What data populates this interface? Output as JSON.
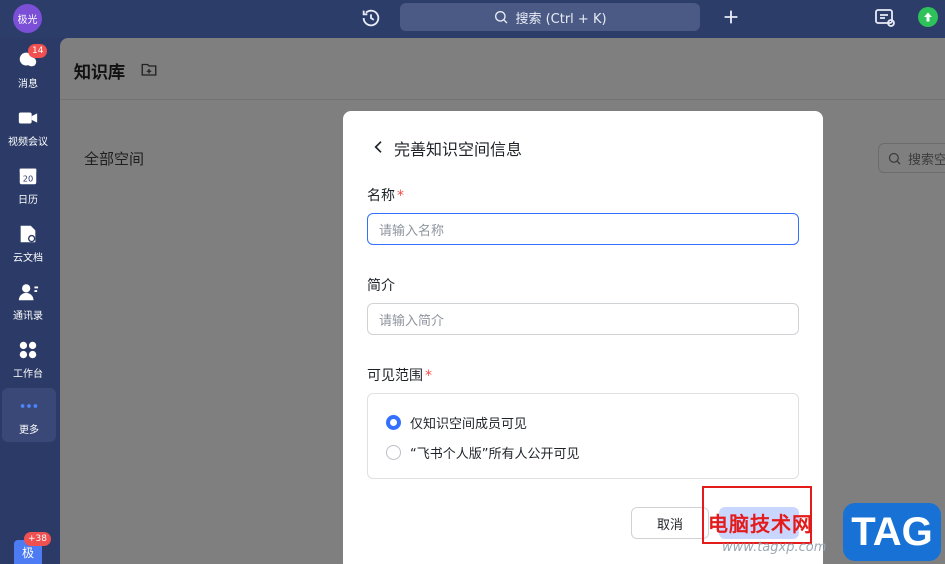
{
  "topbar": {
    "avatar_text": "极光",
    "search_label": "搜索 (Ctrl + K)"
  },
  "sidebar": {
    "items": [
      {
        "label": "消息",
        "badge": "14"
      },
      {
        "label": "视频会议"
      },
      {
        "label": "日历",
        "icon_text": "20"
      },
      {
        "label": "云文档"
      },
      {
        "label": "通讯录"
      },
      {
        "label": "工作台"
      },
      {
        "label": "更多"
      }
    ],
    "bottom_avatar_text": "极",
    "bottom_badge": "+38"
  },
  "main": {
    "title": "知识库",
    "all_spaces": "全部空间",
    "search_placeholder": "搜索空"
  },
  "modal": {
    "title": "完善知识空间信息",
    "name_label": "名称",
    "name_placeholder": "请输入名称",
    "intro_label": "简介",
    "intro_placeholder": "请输入简介",
    "visibility_label": "可见范围",
    "required_mark": "*",
    "options": [
      {
        "label": "仅知识空间成员可见",
        "checked": true
      },
      {
        "label": "“飞书个人版”所有人公开可见",
        "checked": false
      }
    ],
    "cancel_label": "取消"
  },
  "watermark": {
    "site_name": "电脑技术网",
    "url": "www.tagxp.com",
    "tag": "TAG"
  },
  "colors": {
    "accent": "#3370ff",
    "required": "#f54a45",
    "sidebar_bg": "#2b3a66"
  }
}
